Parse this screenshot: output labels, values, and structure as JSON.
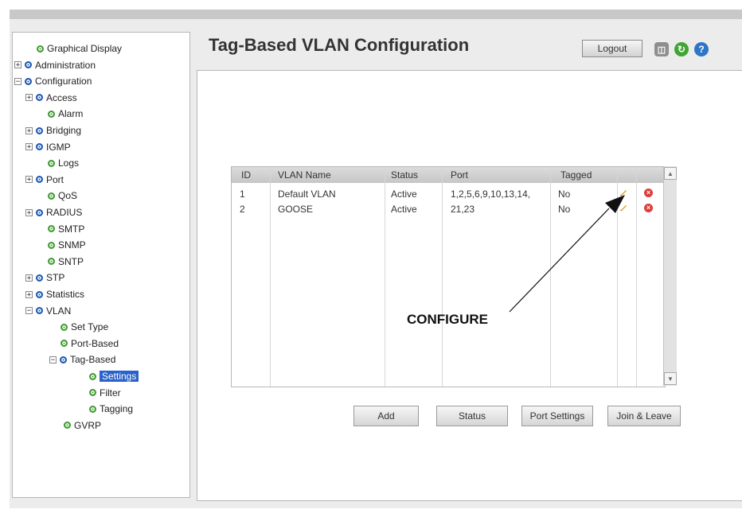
{
  "header": {
    "title": "Tag-Based VLAN Configuration",
    "logout_label": "Logout",
    "icons": [
      "save-icon",
      "refresh-icon",
      "help-icon"
    ]
  },
  "sidebar": {
    "items": [
      {
        "label": "Graphical Display",
        "toggle": "",
        "bullet": "green"
      },
      {
        "label": "Administration",
        "toggle": "+",
        "bullet": "blue"
      },
      {
        "label": "Configuration",
        "toggle": "-",
        "bullet": "blue"
      },
      {
        "label": "Access",
        "toggle": "+",
        "bullet": "blue"
      },
      {
        "label": "Alarm",
        "toggle": "",
        "bullet": "green"
      },
      {
        "label": "Bridging",
        "toggle": "+",
        "bullet": "blue"
      },
      {
        "label": "IGMP",
        "toggle": "+",
        "bullet": "blue"
      },
      {
        "label": "Logs",
        "toggle": "",
        "bullet": "green"
      },
      {
        "label": "Port",
        "toggle": "+",
        "bullet": "blue"
      },
      {
        "label": "QoS",
        "toggle": "",
        "bullet": "green"
      },
      {
        "label": "RADIUS",
        "toggle": "+",
        "bullet": "blue"
      },
      {
        "label": "SMTP",
        "toggle": "",
        "bullet": "green"
      },
      {
        "label": "SNMP",
        "toggle": "",
        "bullet": "green"
      },
      {
        "label": "SNTP",
        "toggle": "",
        "bullet": "green"
      },
      {
        "label": "STP",
        "toggle": "+",
        "bullet": "blue"
      },
      {
        "label": "Statistics",
        "toggle": "+",
        "bullet": "blue"
      },
      {
        "label": "VLAN",
        "toggle": "-",
        "bullet": "blue"
      },
      {
        "label": "Set Type",
        "toggle": "",
        "bullet": "green"
      },
      {
        "label": "Port-Based",
        "toggle": "",
        "bullet": "green"
      },
      {
        "label": "Tag-Based",
        "toggle": "-",
        "bullet": "blue"
      },
      {
        "label": "Settings",
        "toggle": "",
        "bullet": "green",
        "selected": true
      },
      {
        "label": "Filter",
        "toggle": "",
        "bullet": "green"
      },
      {
        "label": "Tagging",
        "toggle": "",
        "bullet": "green"
      },
      {
        "label": "GVRP",
        "toggle": "",
        "bullet": "green"
      }
    ]
  },
  "table": {
    "columns": [
      "ID",
      "VLAN Name",
      "Status",
      "Port",
      "Tagged"
    ],
    "rows": [
      {
        "id": "1",
        "name": "Default VLAN",
        "status": "Active",
        "port": "1,2,5,6,9,10,13,14,",
        "tagged": "No"
      },
      {
        "id": "2",
        "name": "GOOSE",
        "status": "Active",
        "port": "21,23",
        "tagged": "No"
      }
    ]
  },
  "buttons": {
    "add": "Add",
    "status": "Status",
    "port_settings": "Port Settings",
    "join_leave": "Join & Leave"
  },
  "annotation": {
    "text": "CONFIGURE"
  },
  "colors": {
    "selected": "#2a62c9",
    "bullet_blue": "#1a56b0",
    "bullet_green": "#3e9a2f",
    "delete": "#e23b3b"
  }
}
